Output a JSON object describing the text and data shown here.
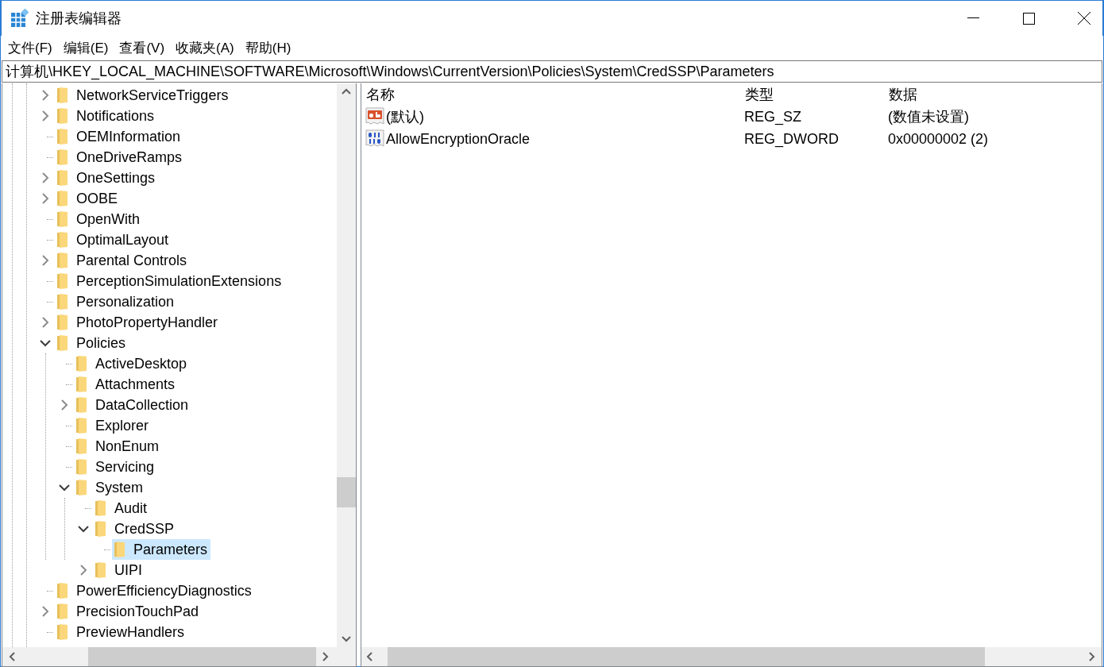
{
  "window": {
    "title": "注册表编辑器"
  },
  "menu": [
    "文件(F)",
    "编辑(E)",
    "查看(V)",
    "收藏夹(A)",
    "帮助(H)"
  ],
  "address": "计算机\\HKEY_LOCAL_MACHINE\\SOFTWARE\\Microsoft\\Windows\\CurrentVersion\\Policies\\System\\CredSSP\\Parameters",
  "tree": [
    {
      "name": "NetworkServiceTriggers",
      "expanded": false,
      "selected": false
    },
    {
      "name": "Notifications",
      "expanded": false,
      "selected": false
    },
    {
      "name": "OEMInformation",
      "selected": false
    },
    {
      "name": "OneDriveRamps",
      "selected": false
    },
    {
      "name": "OneSettings",
      "expanded": false,
      "selected": false
    },
    {
      "name": "OOBE",
      "expanded": false,
      "selected": false
    },
    {
      "name": "OpenWith",
      "selected": false
    },
    {
      "name": "OptimalLayout",
      "selected": false
    },
    {
      "name": "Parental Controls",
      "expanded": false,
      "selected": false
    },
    {
      "name": "PerceptionSimulationExtensions",
      "selected": false
    },
    {
      "name": "Personalization",
      "selected": false
    },
    {
      "name": "PhotoPropertyHandler",
      "expanded": false,
      "selected": false
    },
    {
      "name": "Policies",
      "expanded": true,
      "selected": false,
      "children": [
        {
          "name": "ActiveDesktop",
          "selected": false
        },
        {
          "name": "Attachments",
          "selected": false
        },
        {
          "name": "DataCollection",
          "expanded": false,
          "selected": false
        },
        {
          "name": "Explorer",
          "selected": false
        },
        {
          "name": "NonEnum",
          "selected": false
        },
        {
          "name": "Servicing",
          "selected": false
        },
        {
          "name": "System",
          "expanded": true,
          "selected": false,
          "children": [
            {
              "name": "Audit",
              "selected": false
            },
            {
              "name": "CredSSP",
              "expanded": true,
              "selected": false,
              "children": [
                {
                  "name": "Parameters",
                  "selected": true
                }
              ]
            },
            {
              "name": "UIPI",
              "expanded": false,
              "selected": false
            }
          ]
        }
      ]
    },
    {
      "name": "PowerEfficiencyDiagnostics",
      "selected": false
    },
    {
      "name": "PrecisionTouchPad",
      "expanded": false,
      "selected": false
    },
    {
      "name": "PreviewHandlers",
      "selected": false
    }
  ],
  "values": {
    "columns": [
      "名称",
      "类型",
      "数据"
    ],
    "rows": [
      {
        "kind": "string",
        "name": "(默认)",
        "type": "REG_SZ",
        "data": "(数值未设置)"
      },
      {
        "kind": "binary",
        "name": "AllowEncryptionOracle",
        "type": "REG_DWORD",
        "data": "0x00000002 (2)"
      }
    ]
  }
}
